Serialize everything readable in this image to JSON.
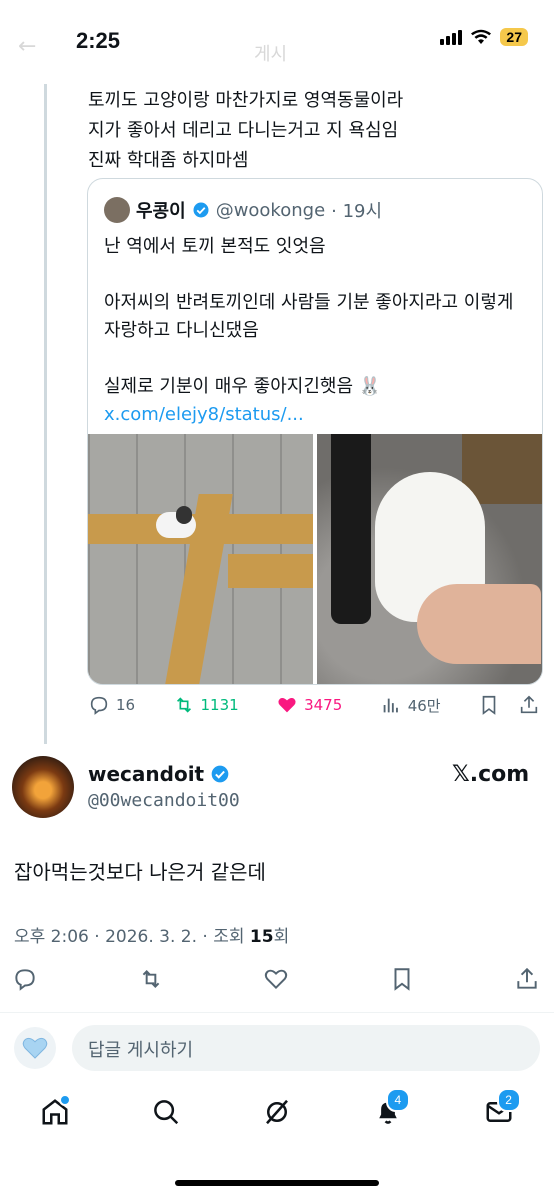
{
  "status_bar": {
    "time": "2:25",
    "battery": "27"
  },
  "header": {
    "title": "게시"
  },
  "parent_tweet": {
    "lines": [
      "토끼도 고양이랑 마찬가지로 영역동물이라",
      "지가 좋아서 데리고 다니는거고 지 욕심임",
      "진짜 학대좀 하지마셈"
    ]
  },
  "quote": {
    "name": "우콩이",
    "handle": "@wookonge",
    "time": "· 19시",
    "para1": "난 역에서 토끼 본적도 잇엇음",
    "para2": "아저씨의 반려토끼인데 사람들 기분 좋아지라고 이렇게 자랑하고 다니신댔음",
    "para3": "실제로 기분이 매우 좋아지긴햇음 🐰",
    "link": "x.com/elejy8/status/..."
  },
  "quote_stats": {
    "replies": "16",
    "reposts": "1131",
    "likes": "3475",
    "views": "46만"
  },
  "main_tweet": {
    "name": "wecandoit",
    "handle": "@00wecandoit00",
    "brand": "𝕏.com",
    "text": "잡아먹는것보다 나은거 같은데",
    "meta_prefix": "오후 2:06 · 2026. 3. 2. · 조회 ",
    "views": "15",
    "meta_suffix": "회"
  },
  "reply": {
    "placeholder": "답글 게시하기"
  },
  "nav": {
    "notifications_badge": "4",
    "messages_badge": "2"
  },
  "colors": {
    "accent": "#1d9bf0",
    "like": "#f91880",
    "repost": "#00ba7c",
    "muted": "#536471"
  }
}
